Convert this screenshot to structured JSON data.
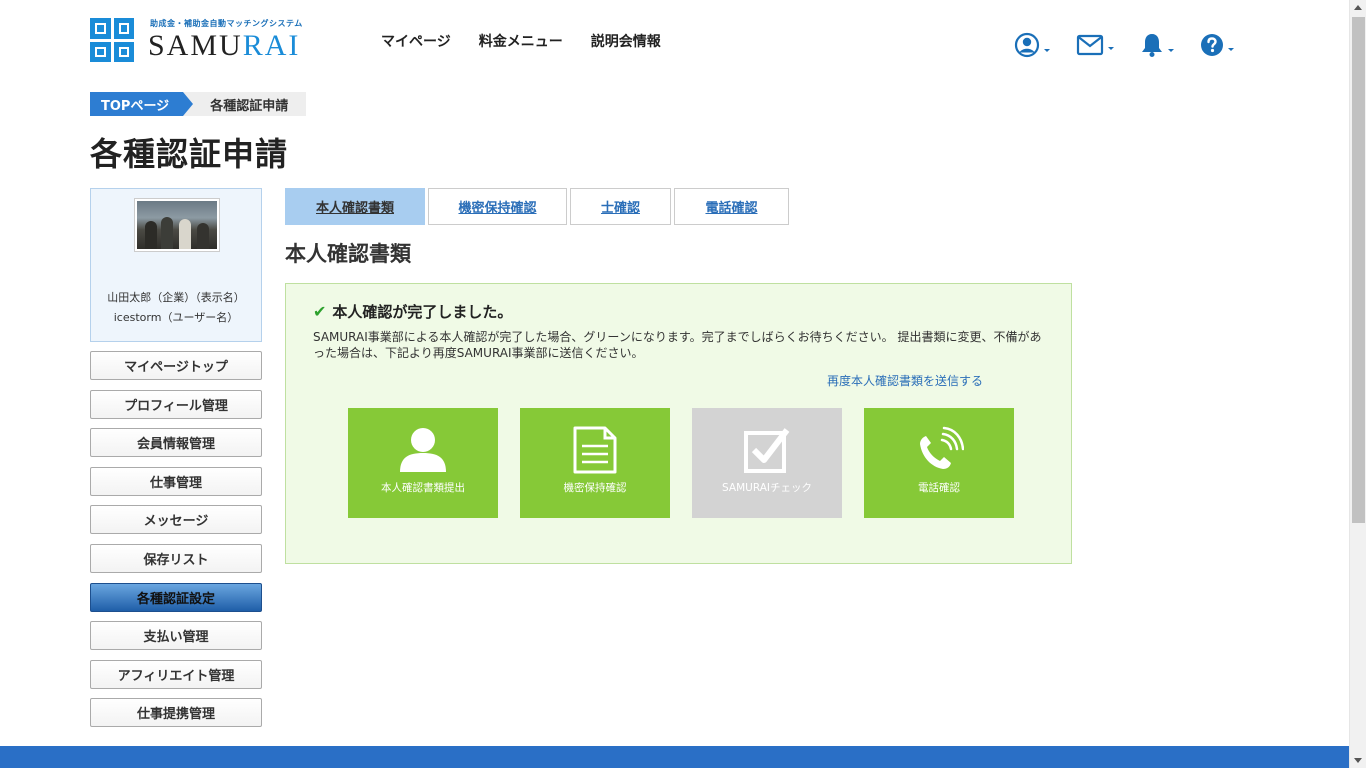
{
  "header": {
    "logo_sub": "助成金・補助金自動マッチングシステム",
    "logo_main_a": "SAMU",
    "logo_main_b": "RAI",
    "nav": [
      "マイページ",
      "料金メニュー",
      "説明会情報"
    ]
  },
  "breadcrumb": {
    "home": "TOPページ",
    "current": "各種認証申請"
  },
  "page_title": "各種認証申請",
  "profile": {
    "display_name": "山田太郎（企業）（表示名）",
    "user_name": "icestorm（ユーザー名）"
  },
  "sidebar": {
    "items": [
      {
        "label": "マイページトップ"
      },
      {
        "label": "プロフィール管理"
      },
      {
        "label": "会員情報管理"
      },
      {
        "label": "仕事管理"
      },
      {
        "label": "メッセージ"
      },
      {
        "label": "保存リスト"
      },
      {
        "label": "各種認証設定"
      },
      {
        "label": "支払い管理"
      },
      {
        "label": "アフィリエイト管理"
      },
      {
        "label": "仕事提携管理"
      }
    ],
    "active_index": 6
  },
  "tabs": [
    {
      "label": "本人確認書類"
    },
    {
      "label": "機密保持確認"
    },
    {
      "label": "士確認"
    },
    {
      "label": "電話確認"
    }
  ],
  "section_title": "本人確認書類",
  "status": {
    "heading": "本人確認が完了しました。",
    "description": "SAMURAI事業部による本人確認が完了した場合、グリーンになります。完了までしばらくお待ちください。 提出書類に変更、不備があった場合は、下記より再度SAMURAI事業部に送信ください。",
    "resend_link": "再度本人確認書類を送信する"
  },
  "tiles": [
    {
      "label": "本人確認書類提出",
      "icon": "user-icon",
      "state": "complete"
    },
    {
      "label": "機密保持確認",
      "icon": "document-icon",
      "state": "complete"
    },
    {
      "label": "SAMURAIチェック",
      "icon": "checkbox-icon",
      "state": "pending"
    },
    {
      "label": "電話確認",
      "icon": "phone-icon",
      "state": "complete"
    }
  ],
  "colors": {
    "brand_blue": "#1a8cd8",
    "complete_green": "#86c937",
    "pending_gray": "#d3d3d3",
    "footer_blue": "#2a6fc6"
  }
}
